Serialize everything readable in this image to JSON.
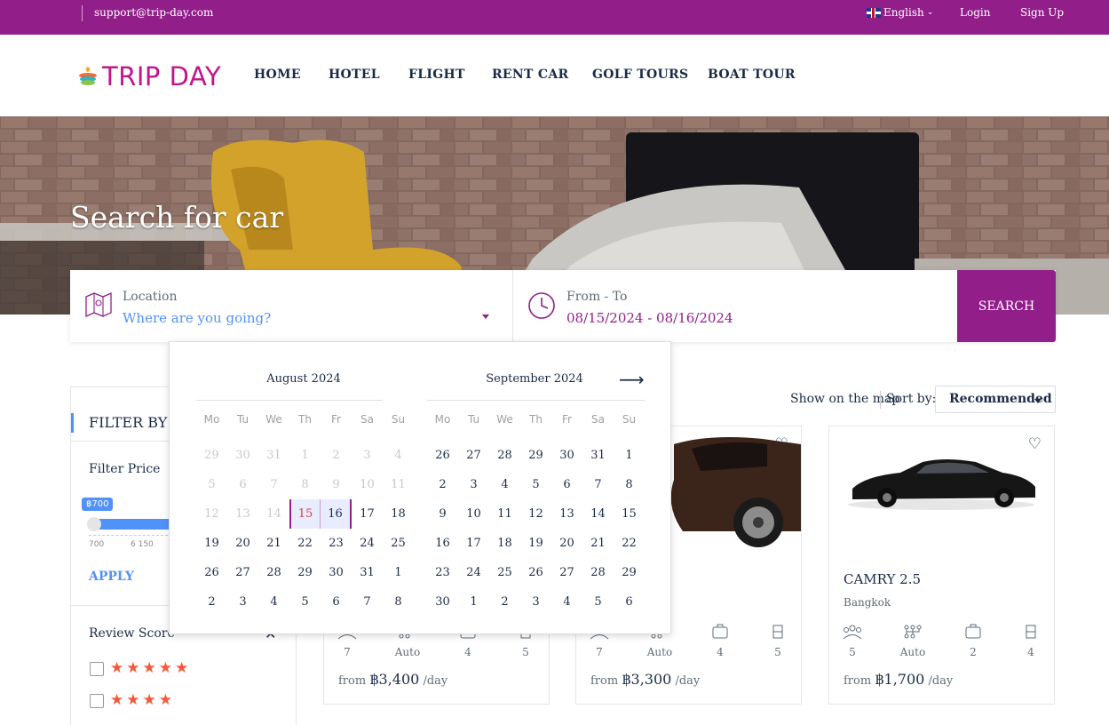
{
  "topbar": {
    "email": "support@trip-day.com",
    "language": "English",
    "login": "Login",
    "signup": "Sign Up"
  },
  "brand": {
    "name": "TRIP DAY"
  },
  "nav": [
    "HOME",
    "HOTEL",
    "FLIGHT",
    "RENT CAR",
    "GOLF TOURS",
    "BOAT TOUR"
  ],
  "hero": {
    "title": "Search for car"
  },
  "search": {
    "location_label": "Location",
    "location_placeholder": "Where are you going?",
    "date_label": "From - To",
    "date_value": "08/15/2024 - 08/16/2024",
    "button": "SEARCH"
  },
  "sidebar": {
    "title": "FILTER BY",
    "price_label": "Filter Price",
    "price_badge": "฿700",
    "tick_min": "700",
    "tick_mid": "6 150",
    "apply": "APPLY",
    "review_label": "Review Score",
    "review_options": [
      "★★★★★",
      "★★★★"
    ]
  },
  "toolbar": {
    "map": "Show on the map",
    "sort_label": "Sort by:",
    "sort_value": "Recommended"
  },
  "cars": [
    {
      "title": "",
      "location": "",
      "seats": "7",
      "transmission": "Auto",
      "bags": "4",
      "doors": "5",
      "price": "฿3,400",
      "unit": "/day",
      "from": "from"
    },
    {
      "title": "",
      "location": "",
      "seats": "7",
      "transmission": "Auto",
      "bags": "4",
      "doors": "5",
      "price": "฿3,300",
      "unit": "/day",
      "from": "from"
    },
    {
      "title": "CAMRY 2.5",
      "location": "Bangkok",
      "seats": "5",
      "transmission": "Auto",
      "bags": "2",
      "doors": "4",
      "price": "฿1,700",
      "unit": "/day",
      "from": "from"
    }
  ],
  "calendar": {
    "weekdays": [
      "Mo",
      "Tu",
      "We",
      "Th",
      "Fr",
      "Sa",
      "Su"
    ],
    "months": [
      {
        "title": "August 2024",
        "weeks": [
          [
            "29",
            "30",
            "31",
            "1",
            "2",
            "3",
            "4"
          ],
          [
            "5",
            "6",
            "7",
            "8",
            "9",
            "10",
            "11"
          ],
          [
            "12",
            "13",
            "14",
            "15",
            "16",
            "17",
            "18"
          ],
          [
            "19",
            "20",
            "21",
            "22",
            "23",
            "24",
            "25"
          ],
          [
            "26",
            "27",
            "28",
            "29",
            "30",
            "31",
            "1"
          ],
          [
            "2",
            "3",
            "4",
            "5",
            "6",
            "7",
            "8"
          ]
        ],
        "disabled_until": 17,
        "selected_start": 17,
        "selected_end": 18
      },
      {
        "title": "September 2024",
        "weeks": [
          [
            "26",
            "27",
            "28",
            "29",
            "30",
            "31",
            "1"
          ],
          [
            "2",
            "3",
            "4",
            "5",
            "6",
            "7",
            "8"
          ],
          [
            "9",
            "10",
            "11",
            "12",
            "13",
            "14",
            "15"
          ],
          [
            "16",
            "17",
            "18",
            "19",
            "20",
            "21",
            "22"
          ],
          [
            "23",
            "24",
            "25",
            "26",
            "27",
            "28",
            "29"
          ],
          [
            "30",
            "1",
            "2",
            "3",
            "4",
            "5",
            "6"
          ]
        ],
        "disabled_until": 0,
        "selected_start": -1,
        "selected_end": -1
      }
    ]
  },
  "colors": {
    "brand": "#921e8a",
    "accent": "#5191fa",
    "star": "#fa5636"
  }
}
